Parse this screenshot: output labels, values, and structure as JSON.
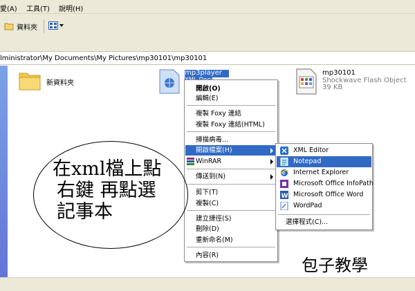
{
  "menubar": {
    "items": [
      "愛(A)",
      "工具(T)",
      "說明(H)"
    ]
  },
  "toolbar": {
    "folders_label": "資料夾"
  },
  "address": {
    "path": "lministrator\\My Documents\\My Pictures\\mp30101\\mp30101"
  },
  "files": {
    "folder_name": "新資料夾",
    "xml_name": "mp3player",
    "xml_subtitle": "XML Document",
    "swf_name": "mp30101",
    "swf_type": "Shockwave Flash Object",
    "swf_size": "39 KB"
  },
  "context_menu": {
    "open": "開啟(O)",
    "edit": "編輯(E)",
    "copy_foxy": "複製 Foxy 連結",
    "copy_foxy_html": "複製 Foxy 連結(HTML)",
    "scan": "掃描病毒...",
    "open_with": "開啟檔案(H)",
    "winrar": "WinRAR",
    "send_to": "傳送到(N)",
    "cut": "剪下(T)",
    "copy": "複製(C)",
    "shortcut": "建立捷徑(S)",
    "delete": "刪除(D)",
    "rename": "重新命名(M)",
    "properties": "內容(R)"
  },
  "open_with_menu": {
    "items": [
      {
        "label": "XML Editor",
        "icon": "xml-editor-icon",
        "color": "#2b6fc7"
      },
      {
        "label": "Notepad",
        "icon": "notepad-icon",
        "color": "#3aa7d6"
      },
      {
        "label": "Internet Explorer",
        "icon": "internet-explorer-icon",
        "color": "#1e63c6"
      },
      {
        "label": "Microsoft Office InfoPath",
        "icon": "infopath-icon",
        "color": "#7a2da8"
      },
      {
        "label": "Microsoft Office Word",
        "icon": "word-icon",
        "color": "#2b5ca8"
      },
      {
        "label": "WordPad",
        "icon": "wordpad-icon",
        "color": "#4a7bd0"
      }
    ],
    "choose_program": "選擇程式(C)..."
  },
  "annotation": {
    "line1": "在xml檔上點",
    "line2": "右鍵 再點選",
    "line3": "記事本"
  },
  "brand": "包子教學",
  "colors": {
    "highlight": "#316ac5",
    "chrome": "#ece9d8",
    "left_pane_top": "#7ba2e7"
  }
}
